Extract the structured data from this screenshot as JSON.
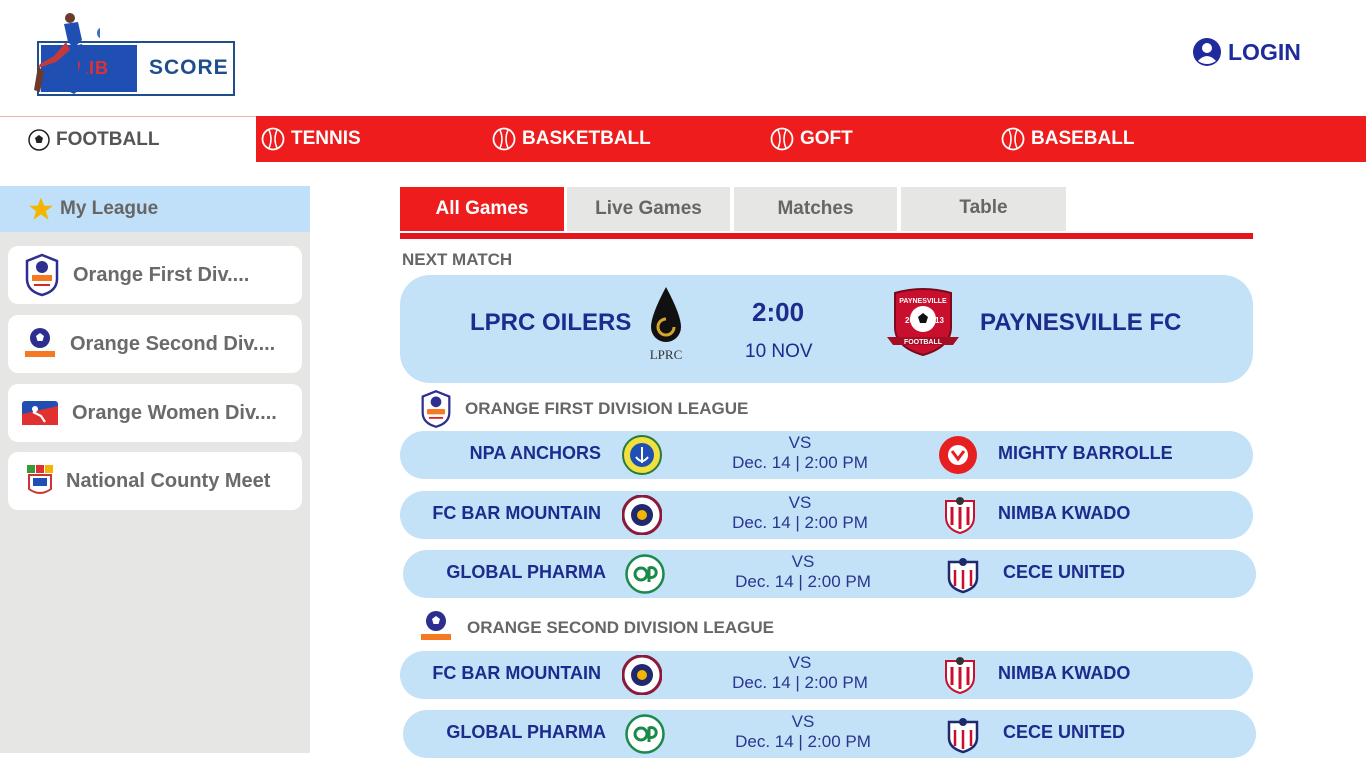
{
  "header": {
    "logo": {
      "left": "LIB",
      "right": "SCORE"
    },
    "login_label": "LOGIN"
  },
  "nav": {
    "items": [
      {
        "label": "FOOTBALL",
        "icon": "soccer-ball-icon",
        "active": true
      },
      {
        "label": "TENNIS",
        "icon": "ball-icon"
      },
      {
        "label": "BASKETBALL",
        "icon": "ball-icon"
      },
      {
        "label": "GOFT",
        "icon": "ball-icon"
      },
      {
        "label": "BASEBALL",
        "icon": "ball-icon"
      }
    ]
  },
  "sidebar": {
    "title": "My League",
    "leagues": [
      {
        "label": "Orange First Div....",
        "icon": "orange-first-division-icon"
      },
      {
        "label": "Orange Second Div....",
        "icon": "orange-second-division-icon"
      },
      {
        "label": "Orange Women Div....",
        "icon": "orange-women-division-icon"
      },
      {
        "label": "National County Meet",
        "icon": "county-meet-icon"
      }
    ]
  },
  "tabs": [
    {
      "label": "All Games",
      "active": true
    },
    {
      "label": "Live Games"
    },
    {
      "label": "Matches"
    },
    {
      "label": "Table"
    }
  ],
  "next_match": {
    "label": "NEXT MATCH",
    "home": "LPRC OILERS",
    "away": "PAYNESVILLE FC",
    "time": "2:00",
    "date": "10 NOV",
    "home_logo_text": "LPRC",
    "away_logo_text": "PAYNESVILLE",
    "away_logo_year_left": "20",
    "away_logo_year_right": "13",
    "away_logo_banner": "FOOTBALL"
  },
  "leagues": [
    {
      "title": "ORANGE FIRST DIVISION LEAGUE",
      "matches": [
        {
          "home": "NPA ANCHORS",
          "away": "MIGHTY  BARROLLE",
          "vs": "VS",
          "datetime": "Dec. 14 | 2:00 PM"
        },
        {
          "home": "FC BAR MOUNTAIN",
          "away": "NIMBA KWADO",
          "vs": "VS",
          "datetime": "Dec. 14 | 2:00 PM"
        },
        {
          "home": "GLOBAL PHARMA",
          "away": "CECE UNITED",
          "vs": "VS",
          "datetime": "Dec. 14 | 2:00 PM"
        }
      ]
    },
    {
      "title": "ORANGE SECOND DIVISION LEAGUE",
      "matches": [
        {
          "home": "FC BAR MOUNTAIN",
          "away": "NIMBA KWADO",
          "vs": "VS",
          "datetime": "Dec. 14 | 2:00 PM"
        },
        {
          "home": "GLOBAL PHARMA",
          "away": "CECE UNITED",
          "vs": "VS",
          "datetime": "Dec. 14 | 2:00 PM"
        }
      ]
    }
  ],
  "colors": {
    "nav_red": "#ee1c1c",
    "team_navy": "#1d2a8e",
    "card_blue": "#c3e1f7",
    "sidebar_gray": "#e6e6e4",
    "star_gold": "#f4b400"
  }
}
